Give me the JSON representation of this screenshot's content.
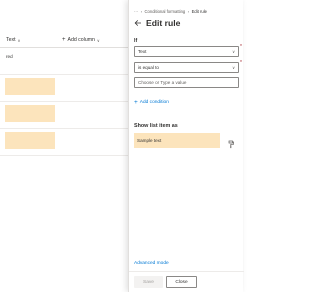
{
  "list": {
    "column_header": "Text",
    "add_column_label": "Add column",
    "rows": [
      {
        "text": "red",
        "highlighted": false
      },
      {
        "text": "",
        "highlighted": true
      },
      {
        "text": "",
        "highlighted": true
      },
      {
        "text": "",
        "highlighted": true
      }
    ],
    "highlight_color": "#fce4bc"
  },
  "panel": {
    "breadcrumb": {
      "more": "···",
      "parent": "Conditional formatting",
      "current": "Edit rule"
    },
    "title": "Edit rule",
    "if_label": "If",
    "column_select": {
      "value": "Text"
    },
    "operator_select": {
      "value": "is equal to"
    },
    "value_input": {
      "placeholder": "Choose or Type a value"
    },
    "add_condition_label": "Add condition",
    "show_as_label": "Show list item as",
    "sample_text": "Sample text",
    "sample_color": "#fce4bc",
    "advanced_mode_label": "Advanced mode",
    "save_label": "Save",
    "close_label": "Close"
  },
  "colors": {
    "accent": "#0078d4",
    "required": "#a4262c"
  }
}
